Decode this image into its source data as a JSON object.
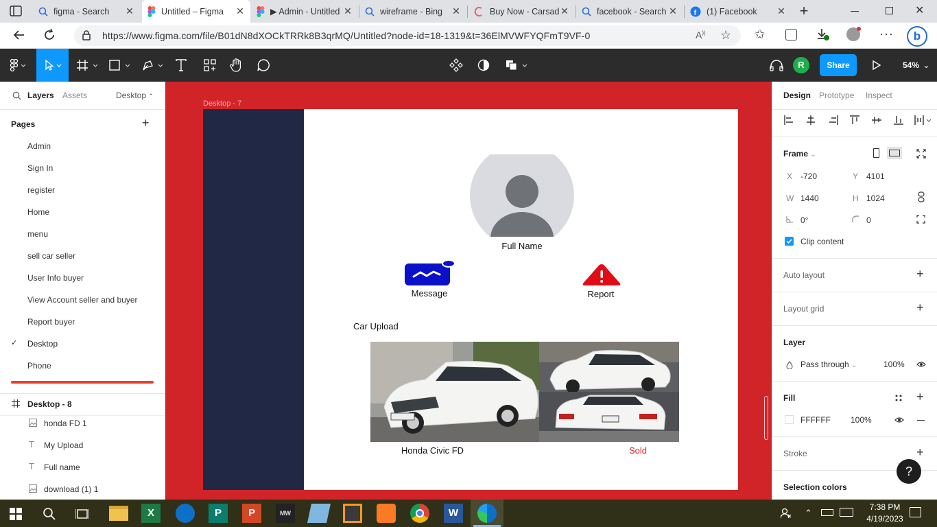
{
  "browser": {
    "tabs": [
      {
        "title": "figma - Search",
        "icon": "search-icon"
      },
      {
        "title": "Untitled – Figma",
        "icon": "figma-icon",
        "active": true
      },
      {
        "title": "▶ Admin - Untitled",
        "icon": "figma-icon"
      },
      {
        "title": "wireframe - Bing",
        "icon": "search-icon"
      },
      {
        "title": "Buy Now - Carsad",
        "icon": "carsad-icon"
      },
      {
        "title": "facebook - Search",
        "icon": "search-icon"
      },
      {
        "title": "(1) Facebook",
        "icon": "facebook-icon"
      }
    ],
    "url": "https://www.figma.com/file/B01dN8dXOCkTRRk8B3qrMQ/Untitled?node-id=18-1319&t=36ElMVWFYQFmT9VF-0"
  },
  "figma_toolbar": {
    "avatar_letter": "R",
    "share_label": "Share",
    "zoom": "54%"
  },
  "left_panel": {
    "tabs": {
      "layers": "Layers",
      "assets": "Assets",
      "page_select": "Desktop"
    },
    "pages_title": "Pages",
    "pages": [
      "Admin",
      "Sign In",
      "register",
      "Home",
      "menu",
      "sell car seller",
      "User Info buyer",
      "View Account seller and buyer",
      "Report buyer",
      "Desktop",
      "Phone"
    ],
    "selected_page": "Desktop",
    "frame_name": "Desktop - 8",
    "layers": [
      {
        "name": "honda FD 1",
        "type": "image"
      },
      {
        "name": "My Upload",
        "type": "text"
      },
      {
        "name": "Full name",
        "type": "text"
      },
      {
        "name": "download (1) 1",
        "type": "image"
      }
    ]
  },
  "canvas": {
    "frame_label": "Desktop - 7",
    "full_name": "Full Name",
    "message_label": "Message",
    "report_label": "Report",
    "car_upload": "Car Upload",
    "car_name": "Honda Civic FD",
    "car_status": "Sold",
    "status_color": "#e0201c",
    "sidebar_color": "#212845",
    "background_color": "#d12428"
  },
  "right_panel": {
    "tabs": [
      "Design",
      "Prototype",
      "Inspect"
    ],
    "frame_label": "Frame",
    "x_label": "X",
    "x": "-720",
    "y_label": "Y",
    "y": "4101",
    "w_label": "W",
    "w": "1440",
    "h_label": "H",
    "h": "1024",
    "rotation": "0°",
    "radius": "0",
    "clip_content": "Clip content",
    "auto_layout": "Auto layout",
    "layout_grid": "Layout grid",
    "layer_title": "Layer",
    "blend": "Pass through",
    "layer_opacity": "100%",
    "fill_title": "Fill",
    "fill_hex": "FFFFFF",
    "fill_opacity": "100%",
    "stroke": "Stroke",
    "selection_colors": "Selection colors",
    "help": "?"
  },
  "taskbar": {
    "time": "7:38 PM",
    "date": "4/19/2023"
  }
}
